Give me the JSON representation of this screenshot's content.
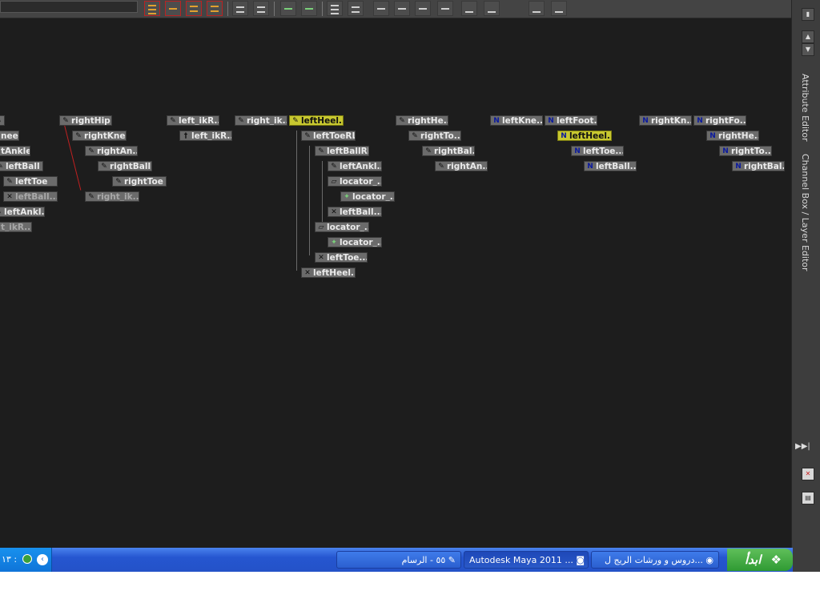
{
  "dock": {
    "tab_attribute": "Attribute Editor",
    "tab_channel": "Channel Box / Layer Editor",
    "skip_glyph": "▶▶|"
  },
  "nodes": {
    "n_nee": "nee",
    "n_tAnkle": "tAnkle",
    "n_leftBall_a": "leftBall",
    "n_leftToe_a": "leftToe",
    "n_leftBall_b": "leftBall...",
    "n_leftAnkl_a": "leftAnkl...",
    "n_t_ikR": "t_ikR...",
    "rightHip": "rightHip",
    "rightKnee": "rightKnee",
    "rightAn": "rightAn...",
    "rightBall": "rightBall",
    "rightToe": "rightToe",
    "right_ik_dim": "right_ik...",
    "left_ikR_a": "left_ikR...",
    "left_ikR_b": "left_ikR...",
    "right_ik": "right_ik...",
    "leftHeel_sel": "leftHeel...",
    "leftToeRL": "leftToeRL",
    "leftBallRL": "leftBallRL",
    "leftAnkl_b": "leftAnkl...",
    "locator_a": "locator_...",
    "locator_b": "locator_...",
    "leftBall_c": "leftBall...",
    "locator_c": "locator_...",
    "locator_d": "locator_...",
    "leftToe_b": "leftToe...",
    "leftHeel_b": "leftHeel...",
    "rightHe": "rightHe...",
    "rightTo": "rightTo...",
    "rightBal": "rightBal...",
    "rightAn_b": "rightAn...",
    "leftKne": "leftKne...",
    "leftFoot": "leftFoot...",
    "leftHeel_ctrl_sel": "leftHeel...",
    "leftToe_c": "leftToe...",
    "leftBall_d": "leftBall...",
    "rightKn": "rightKn...",
    "rightFo": "rightFo...",
    "rightHe_b": "rightHe...",
    "rightTo_b": "rightTo...",
    "rightBal_b": "rightBal..."
  },
  "taskbar": {
    "start_label": "ابدأ",
    "item_chrome": "دروس و ورشات الريج ل...",
    "item_maya": "Autodesk Maya 2011 ...",
    "item_paint": "٥٥ - الرسام",
    "clock": "١٣ :"
  },
  "colors": {
    "selected": "#c8c830",
    "node": "#6b6b6b",
    "background": "#1d1d1d"
  }
}
